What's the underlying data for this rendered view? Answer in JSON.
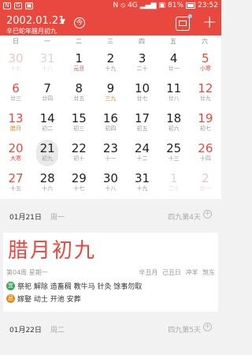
{
  "status_bar": {
    "carrier_icons": [
      "N",
      "G",
      "▣"
    ],
    "network": "4G",
    "battery": "81%",
    "time": "23:52"
  },
  "header": {
    "date": "2002.01.21",
    "lunar": "辛巳蛇年腊月初九",
    "today_label": "今"
  },
  "weekdays": [
    "日",
    "一",
    "二",
    "三",
    "四",
    "五",
    "六"
  ],
  "weeks": [
    [
      {
        "d": "30",
        "l": "十七",
        "o": true
      },
      {
        "d": "31",
        "l": "十八",
        "o": true
      },
      {
        "d": "1",
        "l": "元旦",
        "lc": "red"
      },
      {
        "d": "2",
        "l": "十九"
      },
      {
        "d": "3",
        "l": "二十"
      },
      {
        "d": "4",
        "l": "廿一"
      },
      {
        "d": "5",
        "l": "小寒",
        "lc": "red"
      }
    ],
    [
      {
        "d": "6",
        "l": "廿三"
      },
      {
        "d": "7",
        "l": "廿四"
      },
      {
        "d": "8",
        "l": "廿五"
      },
      {
        "d": "9",
        "l": "三九",
        "lc": "orange"
      },
      {
        "d": "10",
        "l": "廿七"
      },
      {
        "d": "11",
        "l": "廿八"
      },
      {
        "d": "12",
        "l": "廿九"
      }
    ],
    [
      {
        "d": "13",
        "l": "腊月",
        "lc": "orange"
      },
      {
        "d": "14",
        "l": "初二"
      },
      {
        "d": "15",
        "l": "初三"
      },
      {
        "d": "16",
        "l": "初四"
      },
      {
        "d": "17",
        "l": "初五"
      },
      {
        "d": "18",
        "l": "初六"
      },
      {
        "d": "19",
        "l": "初七"
      }
    ],
    [
      {
        "d": "20",
        "l": "大寒",
        "lc": "red"
      },
      {
        "d": "21",
        "l": "初九",
        "sel": true
      },
      {
        "d": "22",
        "l": "初十"
      },
      {
        "d": "23",
        "l": "十一"
      },
      {
        "d": "24",
        "l": "十二"
      },
      {
        "d": "25",
        "l": "十三"
      },
      {
        "d": "26",
        "l": "十四"
      }
    ],
    [
      {
        "d": "27",
        "l": "十五"
      },
      {
        "d": "28",
        "l": "十六"
      },
      {
        "d": "29",
        "l": "十七"
      },
      {
        "d": "30",
        "l": "十八"
      },
      {
        "d": "31",
        "l": "十九"
      },
      {
        "d": "1",
        "l": "二十",
        "o": true
      },
      {
        "d": "2",
        "l": "廿一",
        "o": true
      }
    ]
  ],
  "day_rows": [
    {
      "date": "01月21日",
      "week": "周一",
      "info": "四九第4天"
    },
    {
      "date": "01月22日",
      "week": "周二",
      "info": "四九第5天"
    }
  ],
  "detail": {
    "lunar_big": "腊月初九",
    "week_no": "第04周",
    "weekday": "星期一",
    "ganzhi": "辛丑月 己丑日 冲羊 煞东",
    "yi_label": "宜",
    "yi": "祭祀 解除 造畜稠 教牛马 针灸 馀事勿取",
    "ji_label": "忌",
    "ji": "嫁娶 动土 开池 安葬"
  },
  "colors": {
    "accent": "#e8483d",
    "weekend": "#e8483d",
    "yi": "#3ea65a",
    "ji": "#e38a1a"
  }
}
